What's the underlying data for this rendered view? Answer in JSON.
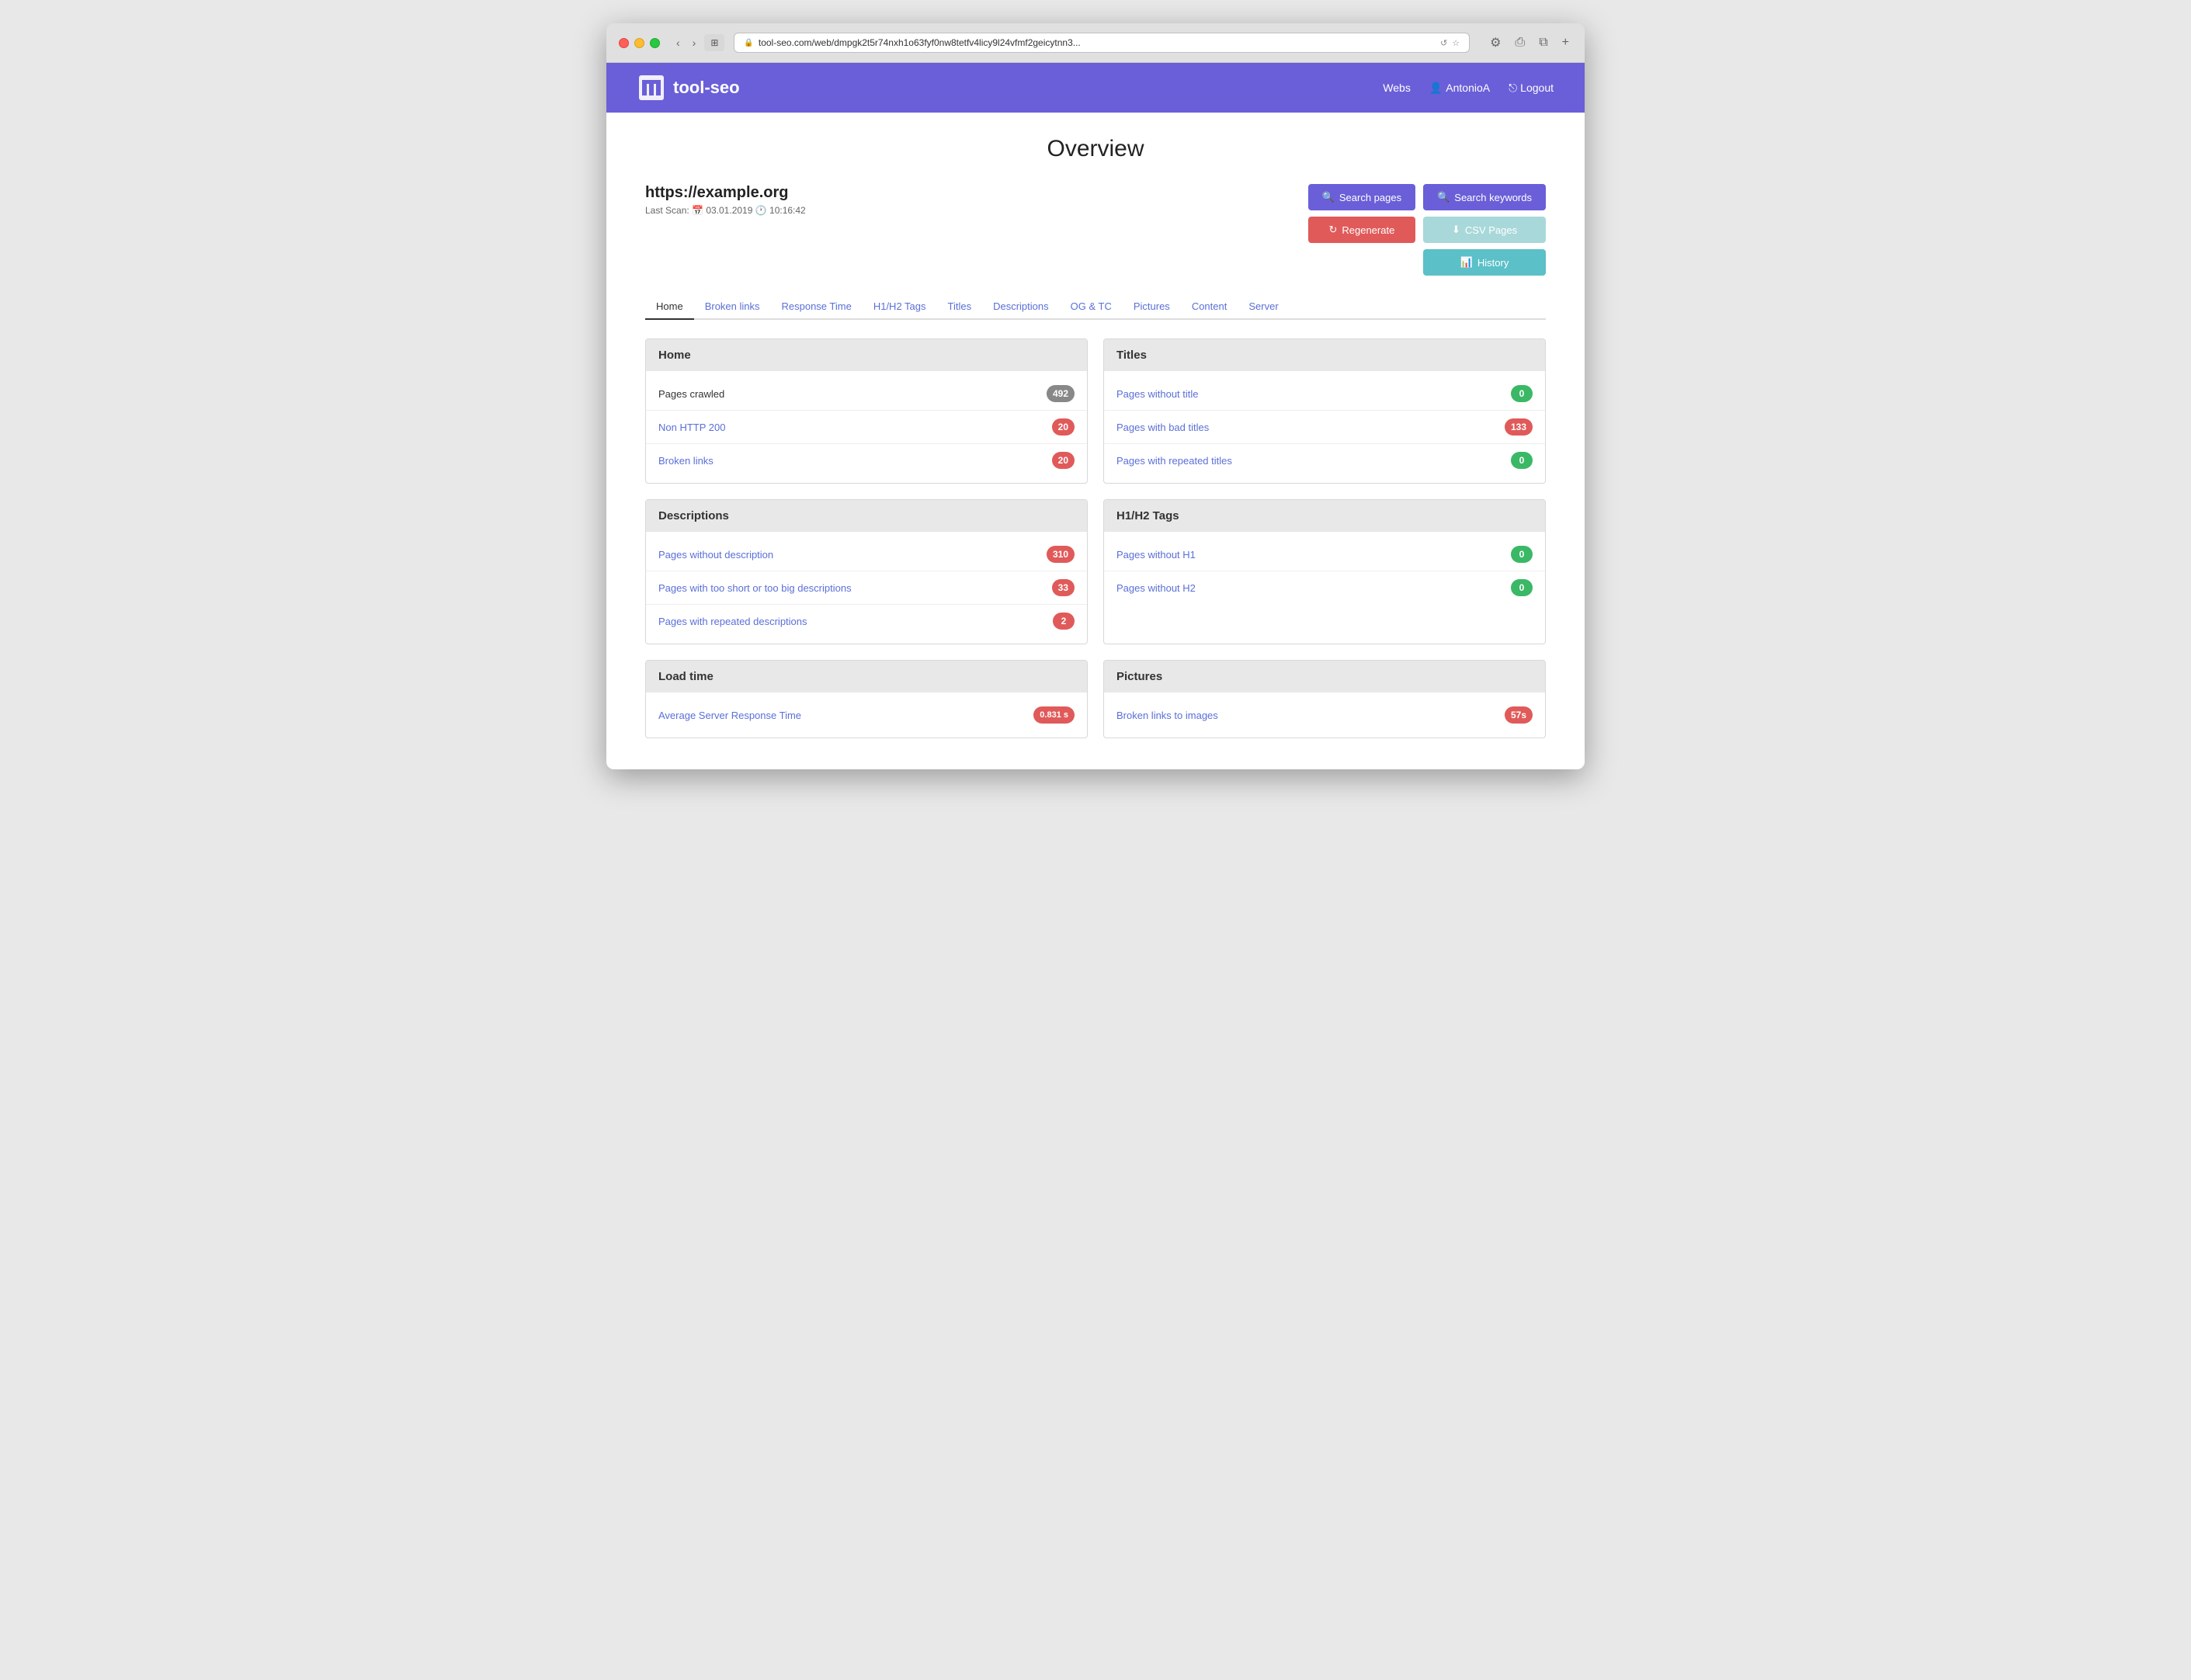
{
  "browser": {
    "url": "tool-seo.com/web/dmpgk2t5r74nxh1o63fyf0nw8tetfv4licy9l24vfmf2geicytnn3...",
    "tab_icon": "⊞"
  },
  "header": {
    "logo_text": "tool-seo",
    "nav_webs": "Webs",
    "nav_user": "AntonioA",
    "nav_logout": "Logout"
  },
  "page": {
    "title": "Overview",
    "site_url": "https://example.org",
    "last_scan_label": "Last Scan:",
    "last_scan_date": "03.01.2019",
    "last_scan_time": "10:16:42"
  },
  "buttons": {
    "search_pages": "Search pages",
    "search_keywords": "Search keywords",
    "regenerate": "Regenerate",
    "csv_pages": "CSV Pages",
    "history": "History"
  },
  "tabs": [
    {
      "label": "Home",
      "active": true
    },
    {
      "label": "Broken links",
      "active": false
    },
    {
      "label": "Response Time",
      "active": false
    },
    {
      "label": "H1/H2 Tags",
      "active": false
    },
    {
      "label": "Titles",
      "active": false
    },
    {
      "label": "Descriptions",
      "active": false
    },
    {
      "label": "OG & TC",
      "active": false
    },
    {
      "label": "Pictures",
      "active": false
    },
    {
      "label": "Content",
      "active": false
    },
    {
      "label": "Server",
      "active": false
    }
  ],
  "cards": {
    "home": {
      "title": "Home",
      "rows": [
        {
          "label": "Pages crawled",
          "value": "492",
          "badge_type": "gray",
          "clickable": false
        },
        {
          "label": "Non HTTP 200",
          "value": "20",
          "badge_type": "red",
          "clickable": true
        },
        {
          "label": "Broken links",
          "value": "20",
          "badge_type": "red",
          "clickable": true
        }
      ]
    },
    "titles": {
      "title": "Titles",
      "rows": [
        {
          "label": "Pages without title",
          "value": "0",
          "badge_type": "green",
          "clickable": true
        },
        {
          "label": "Pages with bad titles",
          "value": "133",
          "badge_type": "red",
          "clickable": true
        },
        {
          "label": "Pages with repeated titles",
          "value": "0",
          "badge_type": "green",
          "clickable": true
        }
      ]
    },
    "descriptions": {
      "title": "Descriptions",
      "rows": [
        {
          "label": "Pages without description",
          "value": "310",
          "badge_type": "red",
          "clickable": true
        },
        {
          "label": "Pages with too short or too big descriptions",
          "value": "33",
          "badge_type": "red",
          "clickable": true
        },
        {
          "label": "Pages with repeated descriptions",
          "value": "2",
          "badge_type": "red",
          "clickable": true
        }
      ]
    },
    "h1h2": {
      "title": "H1/H2 Tags",
      "rows": [
        {
          "label": "Pages without H1",
          "value": "0",
          "badge_type": "green",
          "clickable": true
        },
        {
          "label": "Pages without H2",
          "value": "0",
          "badge_type": "green",
          "clickable": true
        }
      ]
    },
    "loadtime": {
      "title": "Load time",
      "rows": [
        {
          "label": "Average Server Response Time",
          "value": "0.831 s",
          "badge_type": "teal",
          "clickable": true
        }
      ]
    },
    "pictures": {
      "title": "Pictures",
      "rows": [
        {
          "label": "Broken links to images",
          "value": "57s",
          "badge_type": "red",
          "clickable": true
        }
      ]
    }
  }
}
